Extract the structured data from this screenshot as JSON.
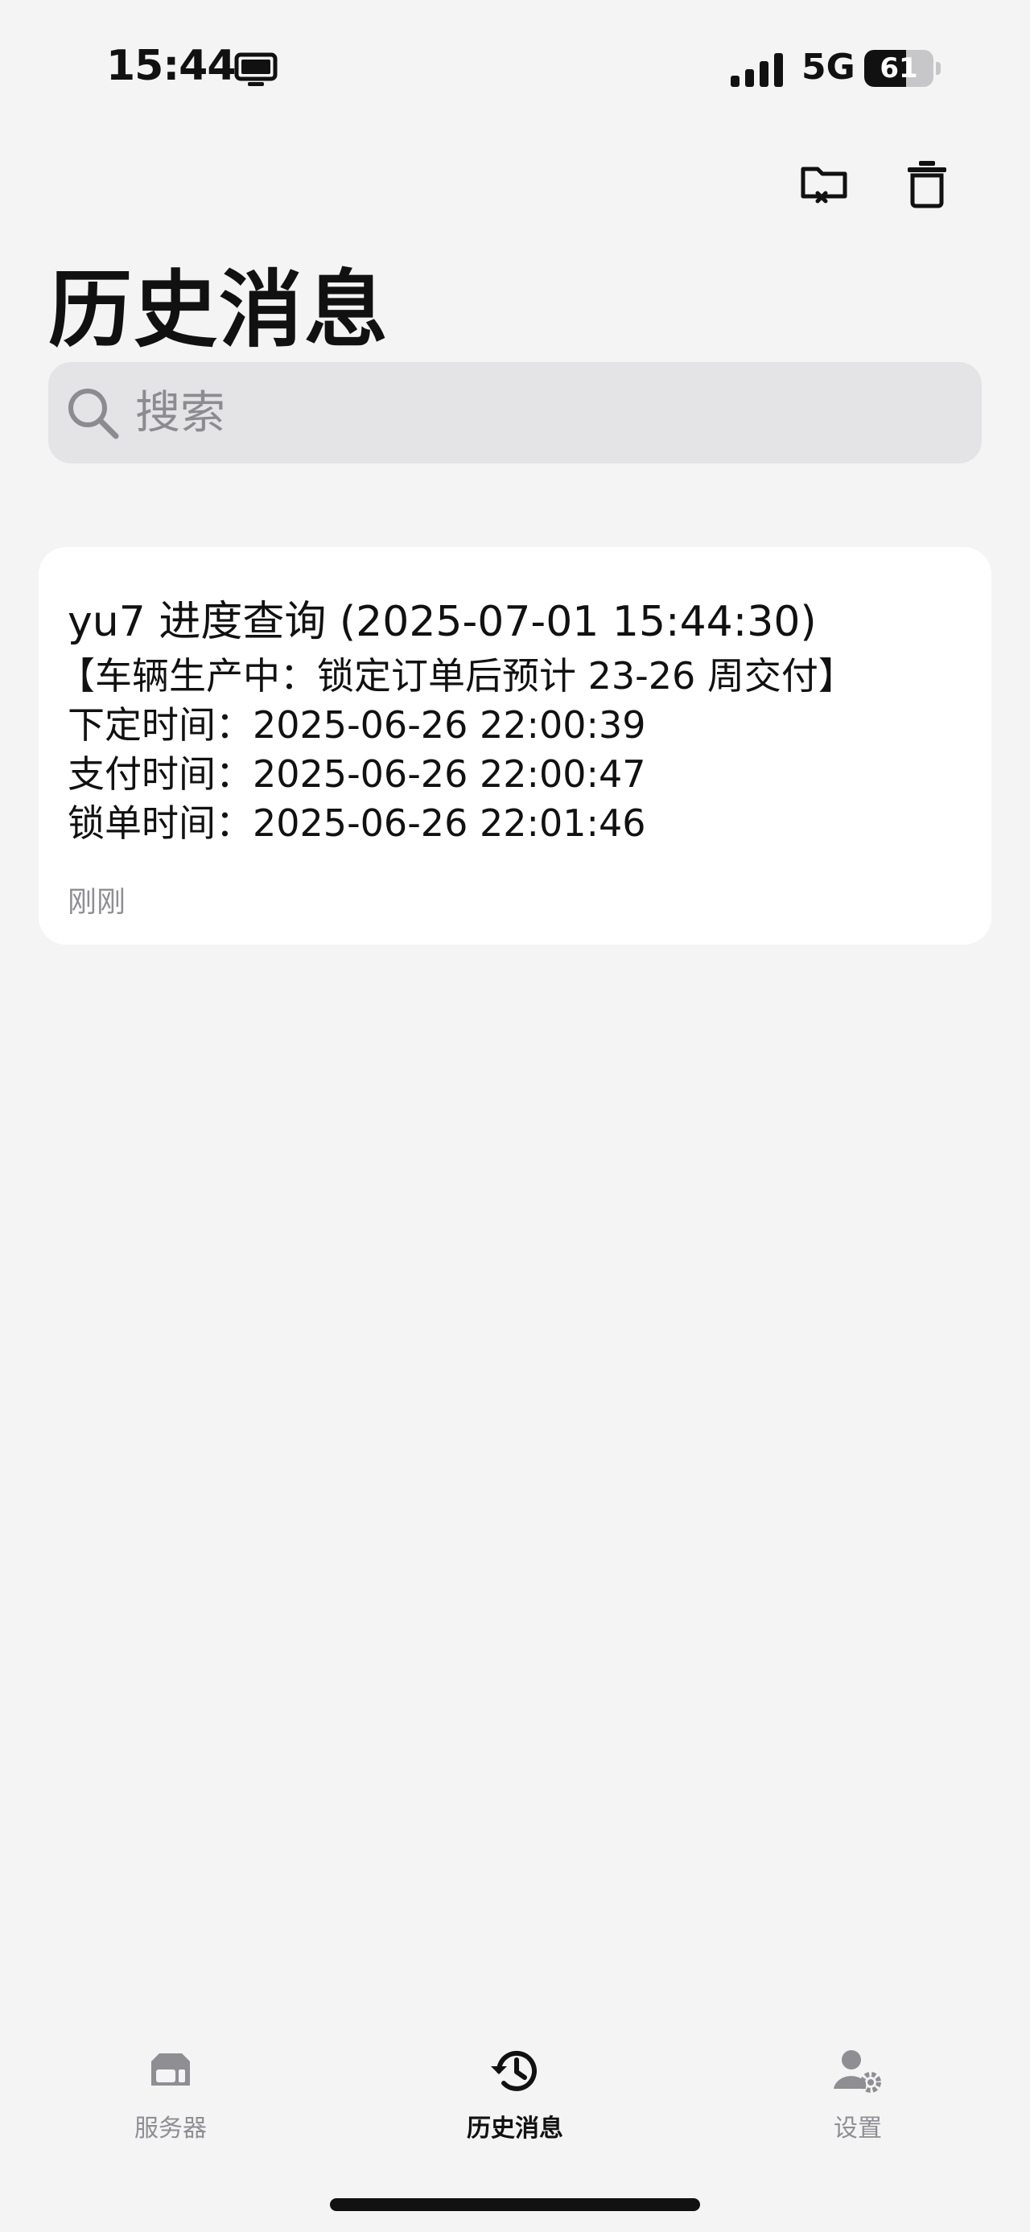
{
  "status_bar": {
    "time": "15:44",
    "network": "5G",
    "battery_level": "61",
    "battery_fraction": 0.61,
    "icons": [
      "screen-mirror-icon",
      "signal-icon",
      "battery-icon"
    ]
  },
  "toolbar": {
    "icons": [
      "folder-clear-icon",
      "trash-icon"
    ]
  },
  "page": {
    "title": "历史消息"
  },
  "search": {
    "placeholder": "搜索",
    "value": ""
  },
  "messages": [
    {
      "title": "yu7 进度查询 (2025-07-01 15:44:30)",
      "lines": [
        "【车辆生产中：锁定订单后预计 23-26 周交付】",
        "下定时间：2025-06-26 22:00:39",
        "支付时间：2025-06-26 22:00:47",
        "锁单时间：2025-06-26 22:01:46"
      ],
      "time": "刚刚"
    }
  ],
  "tabs": [
    {
      "label": "服务器",
      "icon": "server-icon",
      "active": false
    },
    {
      "label": "历史消息",
      "icon": "history-icon",
      "active": true
    },
    {
      "label": "设置",
      "icon": "settings-user-icon",
      "active": false
    }
  ],
  "colors": {
    "background": "#f4f4f5",
    "card": "#ffffff",
    "search_bg": "#e4e4e6",
    "inactive": "#8e8e93",
    "active": "#111111"
  }
}
